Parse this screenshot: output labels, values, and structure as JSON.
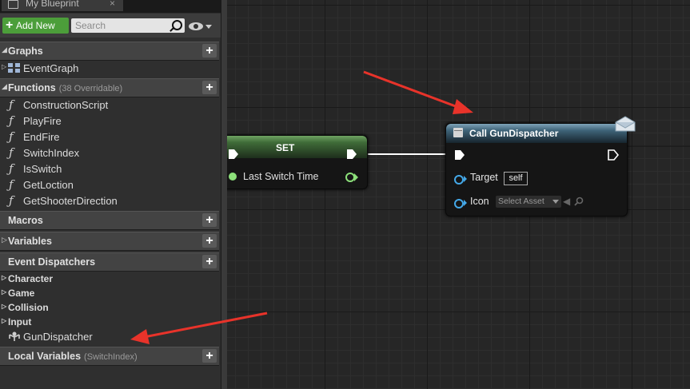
{
  "panel": {
    "tab_title": "My Blueprint",
    "tab_close": "×",
    "add_new_label": "Add New",
    "search_placeholder": "Search",
    "sections": {
      "graphs": {
        "label": "Graphs",
        "items": [
          "EventGraph"
        ]
      },
      "functions": {
        "label": "Functions",
        "sub": "(38 Overridable)",
        "items": [
          "ConstructionScript",
          "PlayFire",
          "EndFire",
          "SwitchIndex",
          "IsSwitch",
          "GetLoction",
          "GetShooterDirection"
        ]
      },
      "macros": {
        "label": "Macros"
      },
      "variables": {
        "label": "Variables"
      },
      "event_dispatchers": {
        "label": "Event Dispatchers",
        "categories": [
          "Character",
          "Game",
          "Collision",
          "Input"
        ],
        "items": [
          "GunDispatcher"
        ]
      },
      "local_variables": {
        "label": "Local Variables",
        "sub": "(SwitchIndex)"
      }
    }
  },
  "graph": {
    "set_node": {
      "title": "SET",
      "pin_label": "Last Switch Time"
    },
    "call_node": {
      "title": "Call GunDispatcher",
      "target_label": "Target",
      "target_value": "self",
      "icon_label": "Icon",
      "icon_value": "Select Asset"
    }
  },
  "colors": {
    "add_new": "#4c9e3a",
    "set_header": "#4f7f46",
    "call_header": "#3e6378",
    "bool_pin": "#8ce07a",
    "object_pin": "#44a8e8",
    "arrow": "#e8332a"
  },
  "icons": [
    "plus-icon",
    "search-icon",
    "eye-icon",
    "function-icon",
    "graph-icon",
    "dispatcher-icon",
    "envelope-icon"
  ]
}
